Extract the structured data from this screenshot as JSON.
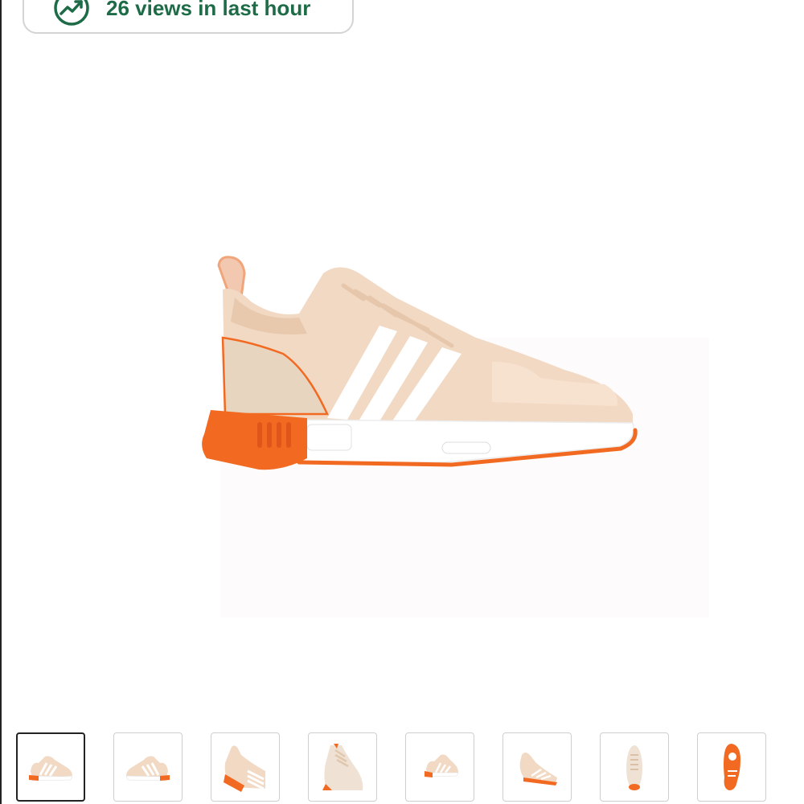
{
  "views_badge": {
    "text": "26 views in last hour",
    "icon": "trend-up-icon",
    "color": "#1e6b47"
  },
  "product": {
    "main_image": "sneaker-side-view",
    "colors": {
      "upper": "#f2d9c4",
      "heel_panel": "#e8d5c0",
      "accent": "#f26a21",
      "stripes": "#ffffff",
      "sole": "#ffffff"
    }
  },
  "thumbnails": [
    {
      "name": "thumbnail-side-view",
      "selected": true
    },
    {
      "name": "thumbnail-side-view-left",
      "selected": false
    },
    {
      "name": "thumbnail-heel-angle",
      "selected": false
    },
    {
      "name": "thumbnail-front-angle",
      "selected": false
    },
    {
      "name": "thumbnail-small-side",
      "selected": false
    },
    {
      "name": "thumbnail-three-quarter",
      "selected": false
    },
    {
      "name": "thumbnail-top-view",
      "selected": false
    },
    {
      "name": "thumbnail-outsole",
      "selected": false
    }
  ]
}
